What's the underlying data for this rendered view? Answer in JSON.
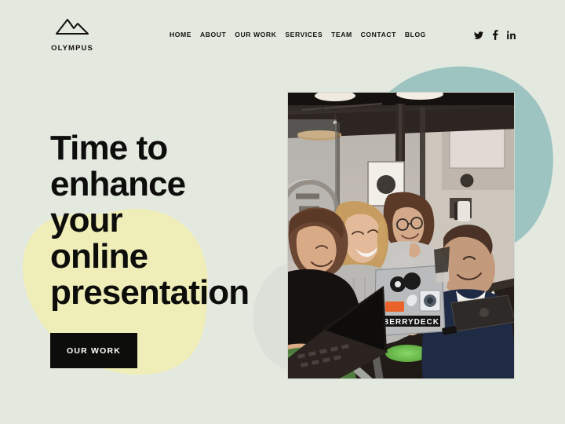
{
  "page": {
    "background_color": "#e4e9e0",
    "accent_yellow": "#f0eeb8",
    "accent_teal": "#9dc4c0",
    "accent_black": "#0d0d0b"
  },
  "header": {
    "brand": {
      "name": "OLYMPUS",
      "mark_icon": "mountain-icon"
    },
    "nav": [
      {
        "label": "HOME"
      },
      {
        "label": "ABOUT"
      },
      {
        "label": "OUR WORK"
      },
      {
        "label": "SERVICES"
      },
      {
        "label": "TEAM"
      },
      {
        "label": "CONTACT"
      },
      {
        "label": "BLOG"
      }
    ],
    "social": [
      {
        "name": "twitter-icon",
        "label": "Twitter"
      },
      {
        "name": "facebook-icon",
        "label": "Facebook"
      },
      {
        "name": "linkedin-icon",
        "label": "LinkedIn"
      }
    ]
  },
  "hero": {
    "title_line_1": "Time to",
    "title_line_2": "enhance your",
    "title_line_3": "online",
    "title_line_4": "presentation",
    "cta_label": "OUR WORK",
    "photo": {
      "name": "team-collaboration-photo",
      "alt": "Four colleagues gathered around laptops at a dark table in a modern office"
    }
  }
}
